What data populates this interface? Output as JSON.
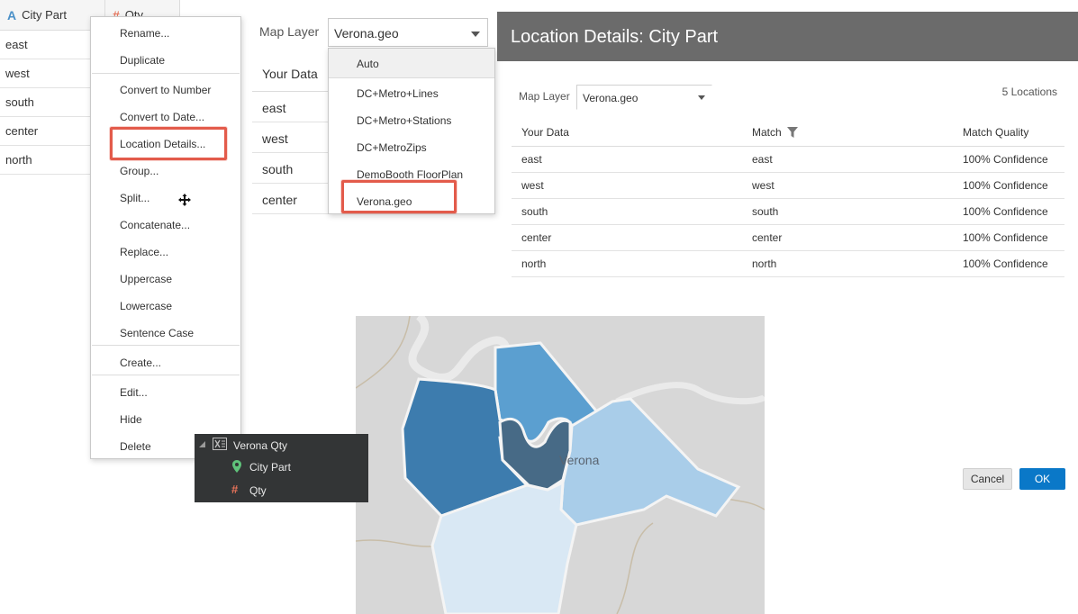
{
  "grid": {
    "col1_header": "City Part",
    "col2_header": "Qty",
    "rows": [
      "east",
      "west",
      "south",
      "center",
      "north"
    ]
  },
  "context_menu": {
    "items": [
      "Rename...",
      "Duplicate",
      "Convert to Number",
      "Convert to Date...",
      "Location Details...",
      "Group...",
      "Split...",
      "Concatenate...",
      "Replace...",
      "Uppercase",
      "Lowercase",
      "Sentence Case",
      "Create...",
      "Edit...",
      "Hide",
      "Delete"
    ],
    "highlighted": "Location Details..."
  },
  "map_layer_panel": {
    "label": "Map Layer",
    "selected": "Verona.geo",
    "table_header": "Your Data",
    "rows": [
      "east",
      "west",
      "south",
      "center"
    ],
    "dropdown_options": [
      "Auto",
      "DC+Metro+Lines",
      "DC+Metro+Stations",
      "DC+MetroZips",
      "DemoBooth FloorPlan",
      "Verona.geo"
    ],
    "highlighted_option": "Verona.geo"
  },
  "dialog": {
    "title": "Location Details: City Part",
    "map_layer_label": "Map Layer",
    "map_layer_value": "Verona.geo",
    "location_count": "5 Locations",
    "columns": [
      "Your Data",
      "Match",
      "Match Quality"
    ],
    "rows": [
      [
        "east",
        "east",
        "100% Confidence"
      ],
      [
        "west",
        "west",
        "100% Confidence"
      ],
      [
        "south",
        "south",
        "100% Confidence"
      ],
      [
        "center",
        "center",
        "100% Confidence"
      ],
      [
        "north",
        "north",
        "100% Confidence"
      ]
    ],
    "cancel_label": "Cancel",
    "ok_label": "OK"
  },
  "map": {
    "city_label": "Verona",
    "region_colors": {
      "north": "#5b9fd0",
      "west": "#3d7cae",
      "center": "#476a86",
      "east": "#a9cde9",
      "south": "#d9e8f4"
    }
  },
  "data_panel": {
    "dataset": "Verona Qty",
    "fields": [
      "City Part",
      "Qty"
    ]
  },
  "colors": {
    "highlight_red": "#e35b4b",
    "dialog_header": "#6b6b6b",
    "ok_blue": "#0a78c8",
    "panel_dark": "#333536"
  }
}
